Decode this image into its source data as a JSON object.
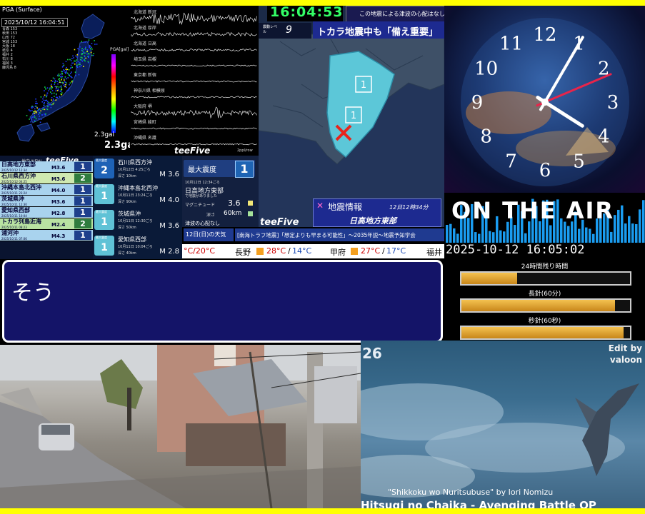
{
  "frame": {
    "border_color": "#ffff00"
  },
  "pga_map": {
    "header_line": "PGA (Surface)",
    "timestamp": "2025/10/12 16:04:51",
    "legend_lines": [
      "青森 153",
      "秋田 153",
      "山形 72",
      "宮城 153",
      "大阪 18",
      "岐阜 4",
      "福井 2",
      "石川 8",
      "福岡 3",
      "鹿児島 8"
    ],
    "scale_label": "PGA[gal]",
    "max_gal": "2.3gal",
    "current_gal": "2.3gal"
  },
  "waveforms": {
    "stations": [
      "北海道 新冠",
      "北海道 厚岸",
      "北海道 日高",
      "埼玉県 岩槻",
      "東京都 新宿",
      "神奈川県 相模原",
      "大阪府 堺",
      "宮崎県 綾町",
      "沖縄県 名護"
    ],
    "footer": "2ppl/row",
    "brand": "teeFive"
  },
  "quake_list": {
    "header": "地中 NEW",
    "brand": "teeFive",
    "rows": [
      {
        "region": "日高地方東部",
        "datetime": "2025/10/12 12:34",
        "magnitude": "M3.6",
        "intensity": "1"
      },
      {
        "region": "石川県西方沖",
        "datetime": "2025/10/12 04:25",
        "magnitude": "M3.6",
        "intensity": "2"
      },
      {
        "region": "沖縄本島北西沖",
        "datetime": "2025/10/11 23:24",
        "magnitude": "M4.0",
        "intensity": "1"
      },
      {
        "region": "茨城県沖",
        "datetime": "2025/10/11 12:30",
        "magnitude": "M3.6",
        "intensity": "1"
      },
      {
        "region": "愛知県西部",
        "datetime": "2025/10/11 10:04",
        "magnitude": "M2.8",
        "intensity": "1"
      },
      {
        "region": "トカラ列島近海",
        "datetime": "2025/10/11 08:23",
        "magnitude": "M2.4",
        "intensity": "2"
      },
      {
        "region": "浦河沖",
        "datetime": "2025/10/11 07:06",
        "magnitude": "M4.3",
        "intensity": "1"
      }
    ]
  },
  "quake_detail": {
    "box_label": "最大震度",
    "rows": [
      {
        "region": "石川県西方沖",
        "time": "10月12日 4:25ごろ",
        "depth": "深さ 10km",
        "magnitude": "M 3.6",
        "intensity": "2"
      },
      {
        "region": "沖縄本島北西沖",
        "time": "10月11日 23:24ごろ",
        "depth": "深さ 90km",
        "magnitude": "M 4.0",
        "intensity": "1"
      },
      {
        "region": "茨城県沖",
        "time": "10月11日 12:30ごろ",
        "depth": "深さ 50km",
        "magnitude": "M 3.6",
        "intensity": "1"
      },
      {
        "region": "愛知県西部",
        "time": "10月11日 10:04ごろ",
        "depth": "深さ 40km",
        "magnitude": "M 2.8",
        "intensity": "1"
      }
    ]
  },
  "max_box": {
    "label": "最大震度",
    "value": "1",
    "time": "10月12日 12:34ごろ",
    "region": "日高地方東部",
    "note": "で地震がありました",
    "magnitude_label": "マグニチュード",
    "magnitude": "3.6",
    "depth_label": "深さ",
    "depth": "60km",
    "tsunami": "津波の心配なし"
  },
  "regional_map": {
    "clock": "16:04:53",
    "tsunami_note": "この地震による津波の心配はなし",
    "level_label": "震動レベル",
    "level": "9",
    "headline": "トカラ地震中も「備え重要」",
    "marker_labels": [
      "1",
      "1"
    ],
    "info_title": "地震情報",
    "info_time": "12日12時34分",
    "info_region": "日高地方東部",
    "brand": "teeFive"
  },
  "ticker": {
    "left_label": "12日(日)の天気",
    "headline": "[南海トラフ地震]「想定よりも早まる可能性」〜2035年説〜地震予知学会",
    "weather": [
      {
        "city": "",
        "temps": "°C/20°C"
      },
      {
        "city": "長野",
        "hi": "28°C",
        "lo": "14°C"
      },
      {
        "city": "甲府",
        "hi": "27°C",
        "lo": "17°C"
      },
      {
        "city": "福井",
        "hi": "",
        "lo": ""
      }
    ]
  },
  "clock": {
    "numbers": [
      "12",
      "1",
      "2",
      "3",
      "4",
      "5",
      "6",
      "7",
      "8",
      "9",
      "10",
      "11"
    ],
    "hour": 4,
    "minute": 5,
    "second": 2
  },
  "on_air": {
    "text": "ON THE AIR"
  },
  "time_panel": {
    "datetime": "2025-10-12 16:05:02",
    "bars": [
      {
        "label": "24時間残り時間",
        "fill": 0.33
      },
      {
        "label": "長針(60分)",
        "fill": 0.91
      },
      {
        "label": "秒針(60秒)",
        "fill": 0.96
      }
    ]
  },
  "subtitle": {
    "text": "そう"
  },
  "anime": {
    "episode": "26",
    "credit_line1": "Edit by",
    "credit_line2": "valoon",
    "song": "\"Shikkoku wo Nuritsubuse\" by Iori Nomizu",
    "title": "Hitsugi no Chaika - Avenging Battle OP"
  }
}
